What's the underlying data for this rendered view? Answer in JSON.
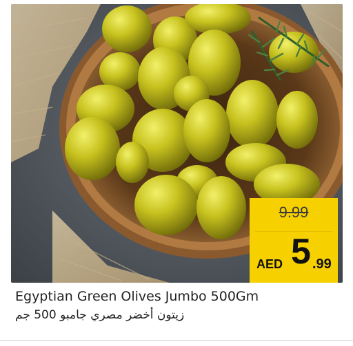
{
  "product": {
    "name_en": "Egyptian Green Olives Jumbo 500Gm",
    "name_ar": "زيتون أخضر مصري جامبو 500 جم",
    "image_icon": "olive-bowl-photo"
  },
  "price": {
    "old": "9.99",
    "currency": "AED",
    "new_integer": "5",
    "new_decimal": ".99"
  },
  "colors": {
    "price_tag": "#f7d000",
    "olive": "#b8b41a",
    "background": "#4b5157",
    "bowl": "#8a5a2e"
  }
}
